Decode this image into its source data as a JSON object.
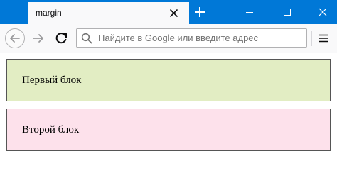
{
  "browser": {
    "tab": {
      "title": "margin"
    },
    "addressbar": {
      "placeholder": "Найдите в Google или введите адрес"
    }
  },
  "page": {
    "blocks": [
      {
        "label": "Первый блок",
        "background": "#e2edc3"
      },
      {
        "label": "Второй блок",
        "background": "#fde1eb"
      }
    ]
  },
  "colors": {
    "titlebar": "#0078d7",
    "toolbar": "#f9f9fa",
    "block_border": "#555555"
  },
  "icons": {
    "tab_close": "close-icon",
    "new_tab": "plus-icon",
    "minimize": "minimize-icon",
    "maximize": "maximize-icon",
    "close_window": "close-icon",
    "back": "arrow-left-icon",
    "forward": "arrow-right-icon",
    "reload": "reload-icon",
    "search": "search-icon",
    "menu": "hamburger-menu-icon"
  }
}
